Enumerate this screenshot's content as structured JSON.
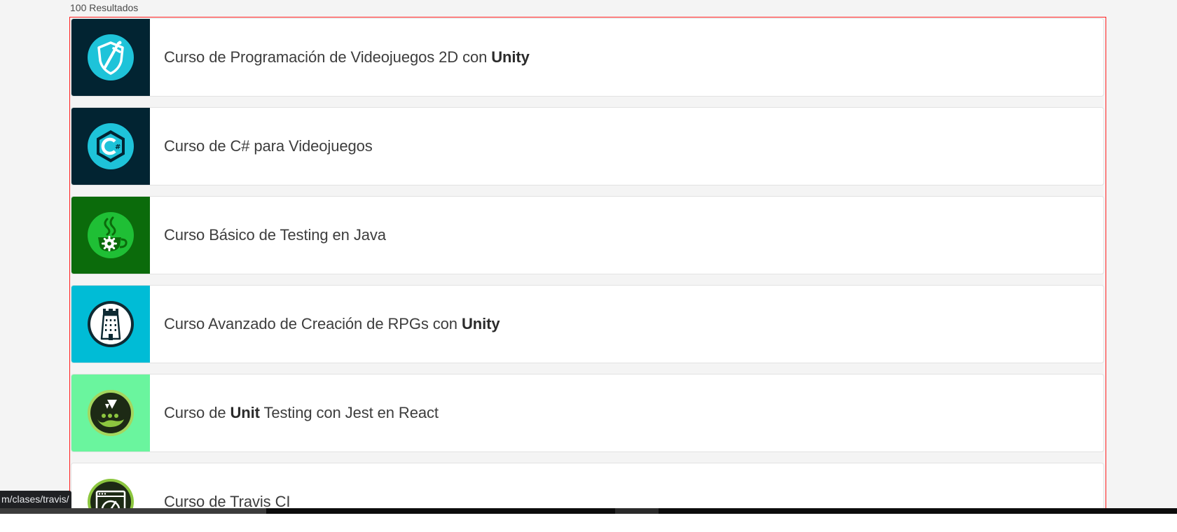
{
  "results": {
    "count_label": "100 Resultados"
  },
  "courses": [
    {
      "title_pre": "Curso de Programación de Videojuegos 2D con ",
      "title_bold": "Unity",
      "title_post": "",
      "thumb_color": "#022432",
      "icon": "shield-sword-icon"
    },
    {
      "title_pre": "Curso de C# para Videojuegos",
      "title_bold": "",
      "title_post": "",
      "thumb_color": "#022432",
      "icon": "csharp-icon"
    },
    {
      "title_pre": "Curso Básico de Testing en Java",
      "title_bold": "",
      "title_post": "",
      "thumb_color": "#0b6b0b",
      "icon": "java-cup-gear-icon"
    },
    {
      "title_pre": "Curso Avanzado de Creación de RPGs con ",
      "title_bold": "Unity",
      "title_post": "",
      "thumb_color": "#00bcd6",
      "icon": "tower-icon"
    },
    {
      "title_pre": "Curso de ",
      "title_bold": "Unit",
      "title_post": " Testing con Jest en React",
      "thumb_color": "#6af59e",
      "icon": "jest-icon"
    },
    {
      "title_pre": "Curso de Travis CI",
      "title_bold": "",
      "title_post": "",
      "thumb_color": "#ffffff",
      "icon": "travis-window-icon"
    }
  ],
  "status_bar": {
    "url_text": "m/clases/travis/"
  },
  "colors": {
    "frame_border": "#ff1f1f",
    "page_bg": "#f4f4f4"
  }
}
